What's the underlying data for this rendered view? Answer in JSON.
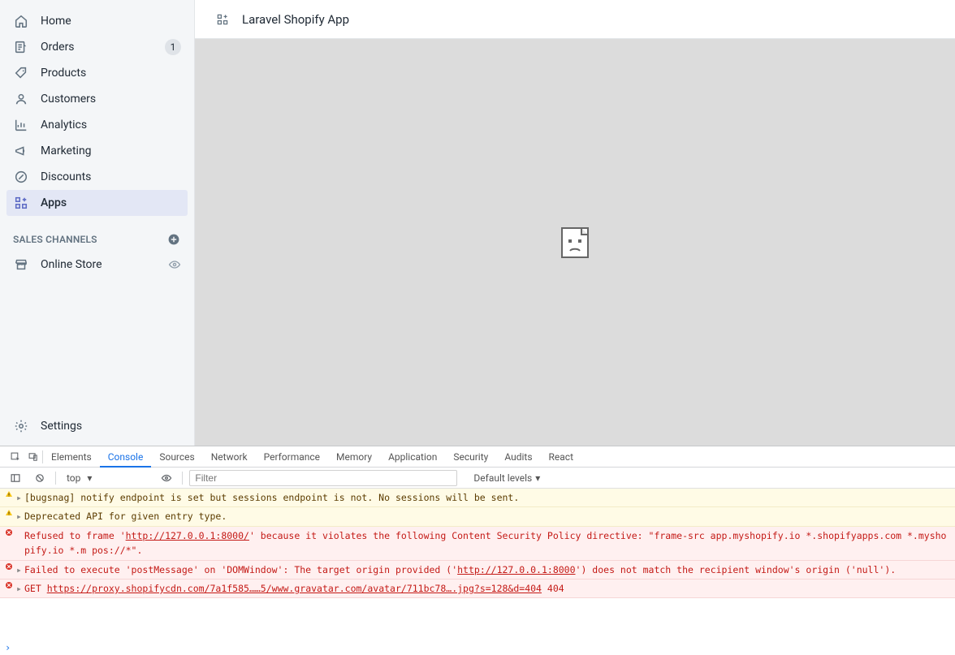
{
  "sidebar": {
    "items": [
      {
        "id": "home",
        "label": "Home",
        "icon": "home-icon"
      },
      {
        "id": "orders",
        "label": "Orders",
        "icon": "orders-icon",
        "badge": "1"
      },
      {
        "id": "products",
        "label": "Products",
        "icon": "products-icon"
      },
      {
        "id": "customers",
        "label": "Customers",
        "icon": "customers-icon"
      },
      {
        "id": "analytics",
        "label": "Analytics",
        "icon": "analytics-icon"
      },
      {
        "id": "marketing",
        "label": "Marketing",
        "icon": "marketing-icon"
      },
      {
        "id": "discounts",
        "label": "Discounts",
        "icon": "discounts-icon"
      },
      {
        "id": "apps",
        "label": "Apps",
        "icon": "apps-icon",
        "active": true
      }
    ],
    "section_title": "SALES CHANNELS",
    "channels": [
      {
        "id": "online-store",
        "label": "Online Store",
        "icon": "store-icon"
      }
    ],
    "settings_label": "Settings"
  },
  "topbar": {
    "title": "Laravel Shopify App",
    "icon": "apps-icon"
  },
  "devtools": {
    "tabs": [
      "Elements",
      "Console",
      "Sources",
      "Network",
      "Performance",
      "Memory",
      "Application",
      "Security",
      "Audits",
      "React"
    ],
    "active_tab": "Console",
    "context": "top",
    "filter_placeholder": "Filter",
    "levels_label": "Default levels",
    "logs": [
      {
        "level": "warn",
        "expandable": true,
        "text": "[bugsnag] notify endpoint is set but sessions endpoint is not. No sessions will be sent."
      },
      {
        "level": "warn",
        "expandable": true,
        "text": "Deprecated API for given entry type."
      },
      {
        "level": "err",
        "expandable": false,
        "html": "Refused to frame '<a>http://127.0.0.1:8000/</a>' because it violates the following Content Security Policy directive: \"frame-src app.myshopify.io *.shopifyapps.com *.myshopify.io *.m pos://*\"."
      },
      {
        "level": "err",
        "expandable": true,
        "html": "Failed to execute 'postMessage' on 'DOMWindow': The target origin provided ('<a>http://127.0.0.1:8000</a>') does not match the recipient window's origin ('null')."
      },
      {
        "level": "err",
        "expandable": true,
        "html": "GET <a>https://proxy.shopifycdn.com/7a1f585……5/www.gravatar.com/avatar/711bc78….jpg?s=128&d=404</a> <span class='code'>404</span>"
      }
    ]
  }
}
